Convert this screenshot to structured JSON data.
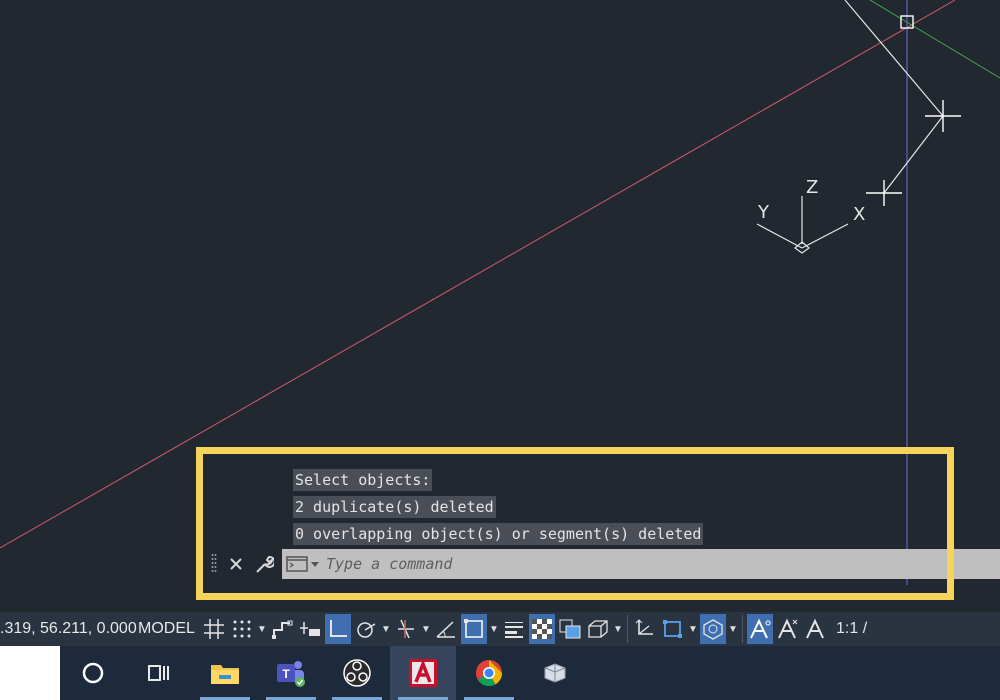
{
  "command_history": [
    "Select objects:",
    "2 duplicate(s) deleted",
    "0 overlapping object(s) or segment(s) deleted"
  ],
  "command_input": {
    "placeholder": "Type a command"
  },
  "ucs_labels": {
    "x": "X",
    "y": "Y",
    "z": "Z"
  },
  "status_bar": {
    "coordinates": ".319, 56.211, 0.000",
    "model_label": "MODEL",
    "scale": "1:1 /"
  },
  "colors": {
    "background": "#212830",
    "highlight": "#f6d35b",
    "red_axis": "#d05a6a",
    "green_axis": "#3fa64a",
    "blue_axis": "#6a6fd8",
    "active_toggle": "#3f6fb0"
  },
  "taskbar": {
    "items": [
      "search-icon",
      "task-view-icon",
      "file-explorer-icon",
      "teams-icon",
      "obs-icon",
      "autocad-icon",
      "chrome-icon",
      "app-icon"
    ]
  }
}
